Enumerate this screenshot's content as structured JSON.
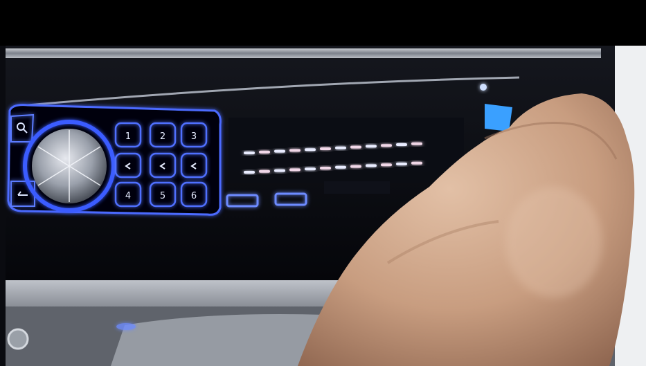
{
  "scene": {
    "description_text": "",
    "colors": {
      "glow": "#3f63ff",
      "glow_light": "#9fb4ff",
      "glow_white": "#eef2ff",
      "panel": "#07080c",
      "chrome": "#c9cdd6",
      "skin": "#caa488",
      "skin_shadow": "#8a6450",
      "usb_blue": "#3aa0ff"
    }
  },
  "faceplate": {
    "brand": "",
    "display_label": "",
    "preset_buttons": [
      {
        "label": "1",
        "icon": "preset-1"
      },
      {
        "label": "2",
        "icon": "preset-2"
      },
      {
        "label": "3",
        "icon": "preset-3"
      },
      {
        "label": "4",
        "icon": "preset-4"
      },
      {
        "label": "5",
        "icon": "preset-5"
      },
      {
        "label": "6",
        "icon": "preset-6"
      }
    ],
    "left_buttons": [
      {
        "icon": "search-icon"
      },
      {
        "icon": "back-icon"
      }
    ],
    "equalizer": {
      "rows": 2,
      "segments_per_row": 12
    }
  }
}
